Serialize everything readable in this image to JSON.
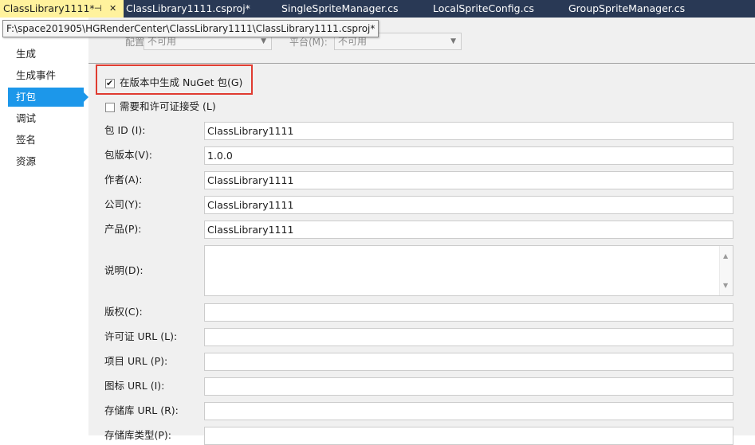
{
  "tabs": [
    {
      "label": "ClassLibrary1111*",
      "pin": "⊣",
      "close": "✕"
    },
    {
      "label": "ClassLibrary1111.csproj*"
    },
    {
      "label": "SingleSpriteManager.cs"
    },
    {
      "label": "LocalSpriteConfig.cs"
    },
    {
      "label": "GroupSpriteManager.cs"
    }
  ],
  "tooltip": "F:\\space201905\\HGRenderCenter\\ClassLibrary1111\\ClassLibrary1111.csproj*",
  "nav": [
    {
      "label": "生成"
    },
    {
      "label": "生成事件"
    },
    {
      "label": "打包"
    },
    {
      "label": "调试"
    },
    {
      "label": "签名"
    },
    {
      "label": "资源"
    }
  ],
  "config": {
    "config_label": "配置(C):",
    "config_value": "不可用",
    "platform_label": "平台(M):",
    "platform_value": "不可用"
  },
  "checkboxes": {
    "generate_nuget": {
      "label": "在版本中生成 NuGet 包(G)",
      "checked": true
    },
    "require_license": {
      "label": "需要和许可证接受 (L)",
      "checked": false
    }
  },
  "fields": [
    {
      "label": "包 ID (I):",
      "value": "ClassLibrary1111"
    },
    {
      "label": "包版本(V):",
      "value": "1.0.0"
    },
    {
      "label": "作者(A):",
      "value": "ClassLibrary1111"
    },
    {
      "label": "公司(Y):",
      "value": "ClassLibrary1111"
    },
    {
      "label": "产品(P):",
      "value": "ClassLibrary1111"
    },
    {
      "label": "说明(D):",
      "value": ""
    },
    {
      "label": "版权(C):",
      "value": ""
    },
    {
      "label": "许可证 URL (L):",
      "value": ""
    },
    {
      "label": "项目 URL (P):",
      "value": ""
    },
    {
      "label": "图标 URL (I):",
      "value": ""
    },
    {
      "label": "存储库 URL (R):",
      "value": ""
    },
    {
      "label": "存储库类型(P):",
      "value": ""
    }
  ],
  "colors": {
    "highlight_box": "#e03c31",
    "nav_active": "#1c97ea",
    "tab_active": "#fff29d",
    "tabbar": "#293955"
  }
}
